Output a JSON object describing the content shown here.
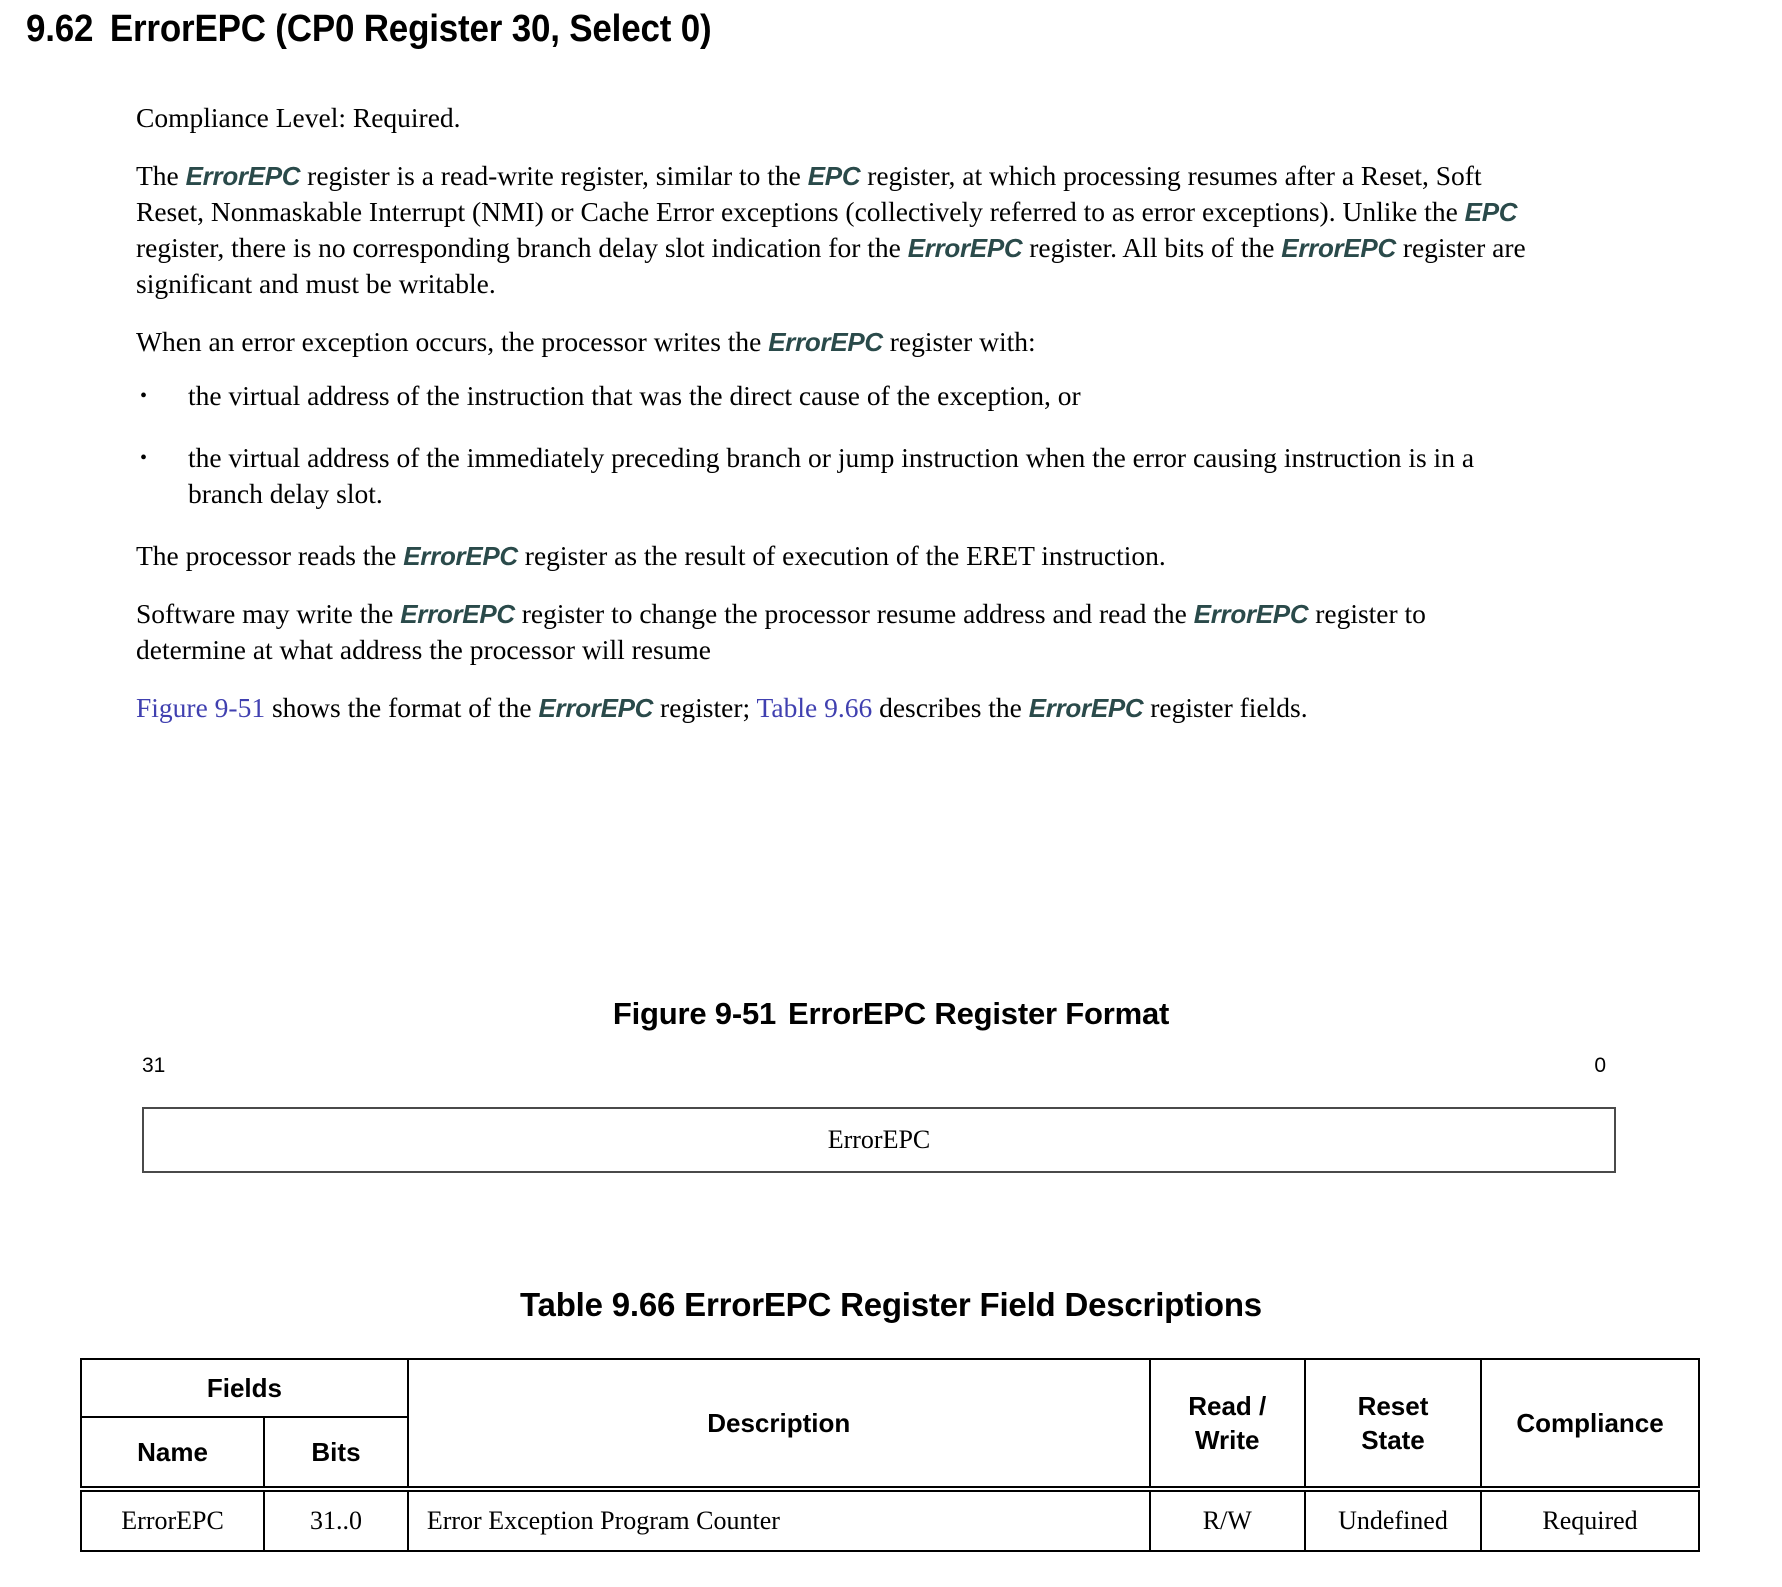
{
  "heading": {
    "number": "9.62",
    "title": "ErrorEPC (CP0 Register 30, Select 0)"
  },
  "body": {
    "compliance_line": "Compliance Level: Required.",
    "p1": {
      "s1": "The ",
      "r1": "ErrorEPC",
      "s2": " register is a read-write register, similar to the ",
      "r2": "EPC",
      "s3": " register, at which processing resumes after a Reset, Soft Reset, Nonmaskable Interrupt (NMI) or Cache Error exceptions (collectively referred to as error exceptions). Unlike the ",
      "r3": "EPC",
      "s4": " register, there is no corresponding branch delay slot indication for the ",
      "r4": "ErrorEPC",
      "s5": " register. All bits of the ",
      "r5": "ErrorEPC",
      "s6": " register are significant and must be writable."
    },
    "p2": {
      "s1": "When an error exception occurs, the processor writes the ",
      "r1": "ErrorEPC",
      "s2": " register with:"
    },
    "bullets": [
      {
        "marker": "•",
        "text": "the virtual address of the instruction that was the direct cause of the exception, or"
      },
      {
        "marker": "•",
        "text": "the virtual address of the immediately preceding branch or jump instruction when the error causing instruction is in a branch delay slot."
      }
    ],
    "p3": {
      "s1": "The processor reads the ",
      "r1": "ErrorEPC",
      "s2": " register as the result of execution of the ERET instruction."
    },
    "p4": {
      "s1": "Software may write the ",
      "r1": "ErrorEPC",
      "s2": " register to change the processor resume address and read the ",
      "r2": "ErrorEPC",
      "s3": " register to determine at what address the processor will resume"
    },
    "p5": {
      "x1": "Figure 9-51",
      "s1": " shows the format of the ",
      "r1": "ErrorEPC",
      "s2": " register; ",
      "x2": "Table 9.66",
      "s3": " describes the ",
      "r2": "ErrorEPC",
      "s4": " register fields."
    }
  },
  "figure": {
    "caption_number": "Figure 9-51",
    "caption_text": "ErrorEPC Register Format",
    "bit_high": "31",
    "bit_low": "0",
    "field_label": "ErrorEPC"
  },
  "table": {
    "caption": "Table 9.66 ErrorEPC Register Field Descriptions",
    "group_header": "Fields",
    "headers": {
      "name": "Name",
      "bits": "Bits",
      "description": "Description",
      "read_write": "Read / Write",
      "read_write_l1": "Read /",
      "read_write_l2": "Write",
      "reset_state": "Reset State",
      "reset_state_l1": "Reset",
      "reset_state_l2": "State",
      "compliance": "Compliance"
    },
    "rows": [
      {
        "name": "ErrorEPC",
        "bits": "31..0",
        "description": "Error Exception Program Counter",
        "read_write": "R/W",
        "reset_state": "Undefined",
        "compliance": "Required"
      }
    ]
  },
  "colors": {
    "register_emphasis": "#2a4a4a",
    "cross_reference_link": "#4040b0",
    "text": "#000000",
    "box_border": "#4a4a4a",
    "table_border": "#000000"
  }
}
